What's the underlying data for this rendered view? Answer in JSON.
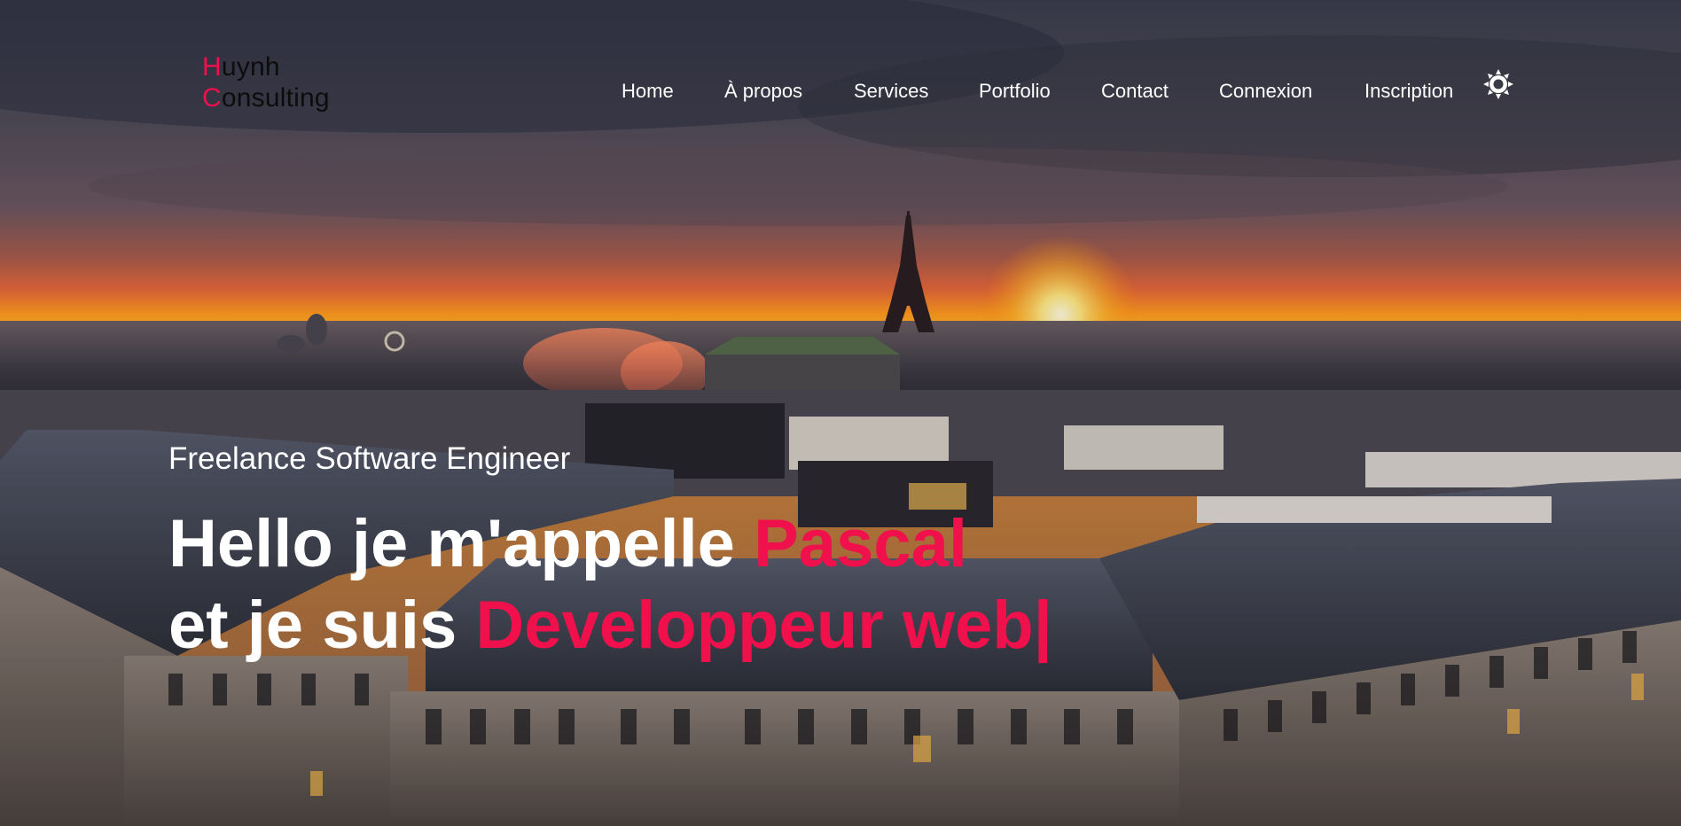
{
  "brand": {
    "logo_line1_initial": "H",
    "logo_line1_rest": "uynh",
    "logo_line2_initial": "C",
    "logo_line2_rest": "onsulting",
    "accent_color": "#f0104c"
  },
  "nav": {
    "items": [
      {
        "label": "Home"
      },
      {
        "label": "À propos"
      },
      {
        "label": "Services"
      },
      {
        "label": "Portfolio"
      },
      {
        "label": "Contact"
      },
      {
        "label": "Connexion"
      },
      {
        "label": "Inscription"
      }
    ],
    "theme_toggle_icon": "sun-icon"
  },
  "hero": {
    "subtitle": "Freelance Software Engineer",
    "line1_prefix": "Hello je m'appelle ",
    "line1_name": "Pascal",
    "line2_prefix": "et je suis ",
    "line2_role": "Developpeur web",
    "typing_cursor": "|",
    "background_icon": "paris-sunset-skyline-image"
  }
}
